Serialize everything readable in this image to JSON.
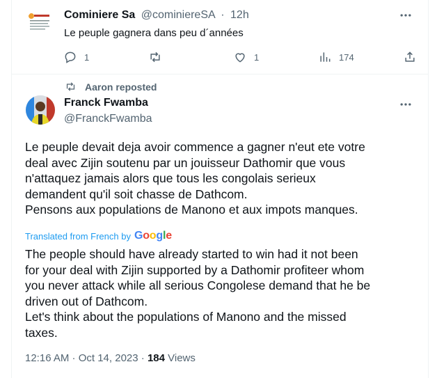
{
  "tweet1": {
    "name": "Cominiere Sa",
    "handle": "@cominiereSA",
    "separator": "·",
    "time": "12h",
    "text": "Le peuple gagnera dans peu d´années",
    "reply_count": "1",
    "retweet_count": "",
    "like_count": "1",
    "view_count": "174"
  },
  "repost_label": "Aaron reposted",
  "tweet2": {
    "name": "Franck Fwamba",
    "handle": "@FranckFwamba",
    "text_lines": [
      "Le peuple devait deja avoir commence a gagner n'eut ete votre",
      "deal avec Zijin soutenu par un jouisseur Dathomir que vous",
      "n'attaquez jamais alors que tous les congolais serieux",
      "demandent qu'il soit chasse de Dathcom.",
      "Pensons aux populations de Manono et aux impots manques."
    ],
    "translated_label": "Translated from French by",
    "google_letters": [
      "G",
      "o",
      "o",
      "g",
      "l",
      "e"
    ],
    "translation_lines": [
      "The people should have already started to win had it not been",
      "for your deal with Zijin supported by a Dathomir profiteer whom",
      "you never attack while all serious Congolese demand that he be",
      "driven out of Dathcom.",
      "Let's think about the populations of Manono and the missed",
      "taxes."
    ],
    "timestamp": "12:16 AM · Oct 14, 2023 ·",
    "views_count": "184",
    "views_label": "Views"
  },
  "icons": {
    "more": "more-horizontal-icon",
    "reply": "reply-icon",
    "retweet": "retweet-icon",
    "like": "heart-icon",
    "views": "analytics-icon",
    "share": "share-icon"
  },
  "colors": {
    "text": "#0f1419",
    "secondary": "#536471",
    "link": "#1d9bf0",
    "border": "#eff3f4"
  }
}
